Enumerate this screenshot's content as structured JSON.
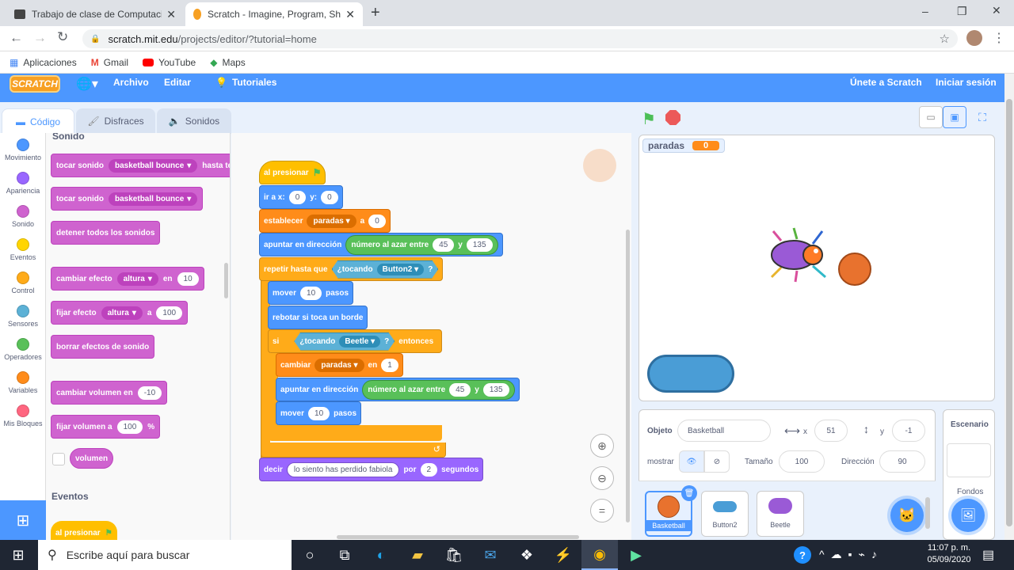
{
  "browser": {
    "tabs": [
      {
        "title": "Trabajo de clase de Computación",
        "close": "✕"
      },
      {
        "title": "Scratch - Imagine, Program, Share",
        "close": "✕"
      }
    ],
    "new_tab": "+",
    "url_host": "scratch.mit.edu",
    "url_path": "/projects/editor/?tutorial=home",
    "bookmarks": [
      "Aplicaciones",
      "Gmail",
      "YouTube",
      "Maps"
    ],
    "window_controls": [
      "–",
      "❐",
      "✕"
    ]
  },
  "scratch_menu": {
    "logo": "SCRATCH",
    "archivo": "Archivo",
    "editar": "Editar",
    "tutoriales": "Tutoriales",
    "join": "Únete a Scratch",
    "signin": "Iniciar sesión"
  },
  "editor_tabs": {
    "code": "Código",
    "costumes": "Disfraces",
    "sounds": "Sonidos"
  },
  "categories": [
    {
      "label": "Movimiento",
      "color": "#4c97ff"
    },
    {
      "label": "Apariencia",
      "color": "#9966ff"
    },
    {
      "label": "Sonido",
      "color": "#cf63cf"
    },
    {
      "label": "Eventos",
      "color": "#ffd500"
    },
    {
      "label": "Control",
      "color": "#ffab19"
    },
    {
      "label": "Sensores",
      "color": "#5cb1d6"
    },
    {
      "label": "Operadores",
      "color": "#59c059"
    },
    {
      "label": "Variables",
      "color": "#ff8c1a"
    },
    {
      "label": "Mis Bloques",
      "color": "#ff6680"
    }
  ],
  "palette": {
    "section_sound": "Sonido",
    "play_until": "tocar sonido",
    "sound_name": "basketball bounce",
    "until_done": "hasta term",
    "start_sound": "tocar sonido",
    "stop_all": "detener todos los sonidos",
    "change_effect": "cambiar efecto",
    "effect_name": "altura",
    "by": "en",
    "change_val": "10",
    "set_effect": "fijar efecto",
    "to": "a",
    "set_val": "100",
    "clear_effects": "borrar efectos de sonido",
    "change_volume": "cambiar volumen en",
    "change_volume_val": "-10",
    "set_volume": "fijar volumen a",
    "set_volume_val": "100",
    "percent": "%",
    "volume": "volumen",
    "section_events": "Eventos",
    "when_flag": "al presionar"
  },
  "script": {
    "when_flag": "al presionar",
    "goto": "ir a x:",
    "goto_x": "0",
    "goto_y_label": "y:",
    "goto_y": "0",
    "set_var": "establecer",
    "var_name": "paradas",
    "set_to": "a",
    "set_val": "0",
    "point_dir": "apuntar en dirección",
    "random": "número al azar entre",
    "rand_a": "45",
    "rand_y": "y",
    "rand_b": "135",
    "repeat_until": "repetir hasta que",
    "touching": "¿tocando",
    "touch1": "Button2",
    "q": "?",
    "move": "mover",
    "move_val": "10",
    "steps": "pasos",
    "bounce": "rebotar si toca un borde",
    "if": "si",
    "touch2": "Beetle",
    "then": "entonces",
    "change": "cambiar",
    "change_by": "en",
    "change_val": "1",
    "say": "decir",
    "say_text": "lo siento has perdido fabiola",
    "say_for": "por",
    "say_secs": "2",
    "seconds": "segundos"
  },
  "stage": {
    "monitor_label": "paradas",
    "monitor_value": "0"
  },
  "sprite_info": {
    "object_label": "Objeto",
    "object_name": "Basketball",
    "x_label": "x",
    "x_val": "51",
    "y_label": "y",
    "y_val": "-1",
    "show_label": "mostrar",
    "size_label": "Tamaño",
    "size_val": "100",
    "dir_label": "Dirección",
    "dir_val": "90",
    "sprites": [
      "Basketball",
      "Button2",
      "Beetle"
    ],
    "stage_label": "Escenario",
    "backdrops_label": "Fondos"
  },
  "taskbar": {
    "search_placeholder": "Escribe aquí para buscar",
    "time": "11:07 p. m.",
    "date": "05/09/2020"
  }
}
